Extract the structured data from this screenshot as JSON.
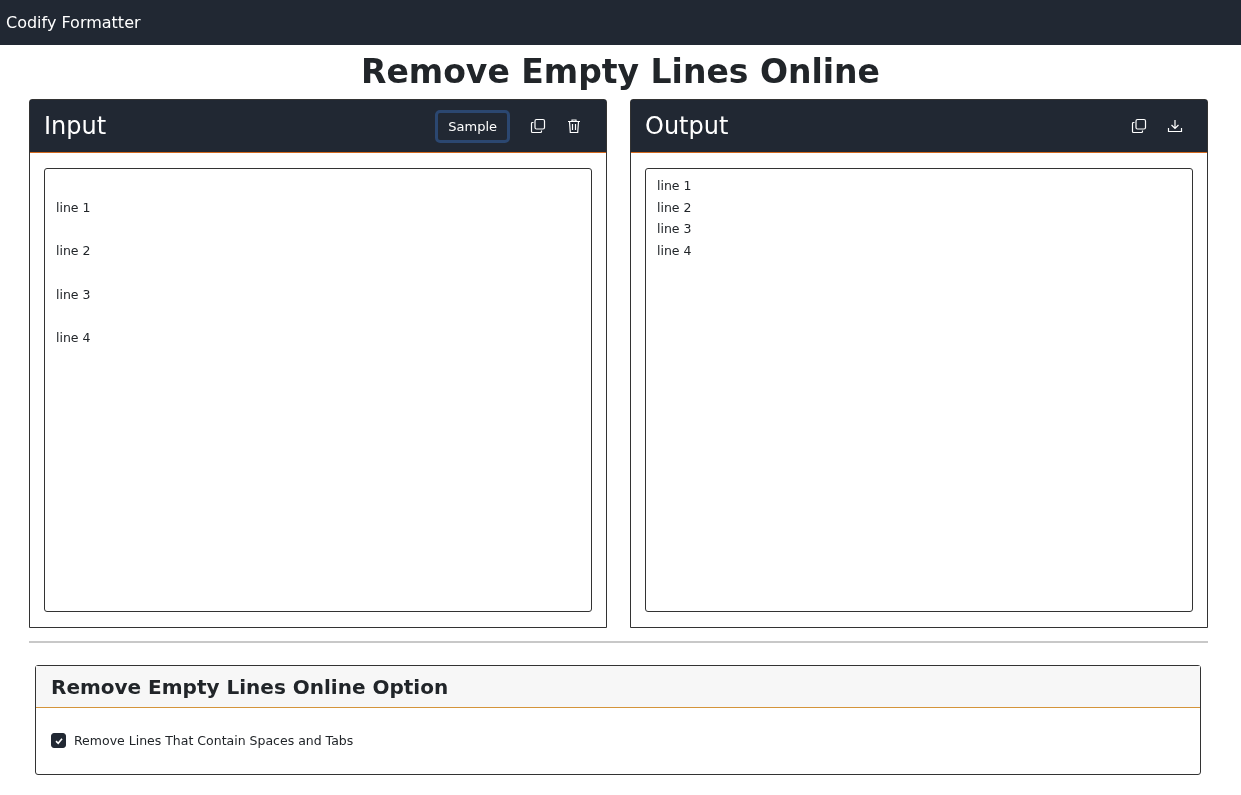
{
  "navbar": {
    "brand": "Codify Formatter"
  },
  "page_title": "Remove Empty Lines Online",
  "input_panel": {
    "title": "Input",
    "sample_button": "Sample",
    "value": "\nline 1\n\nline 2\n\nline 3\n\nline 4"
  },
  "output_panel": {
    "title": "Output",
    "value": "line 1\nline 2\nline 3\nline 4"
  },
  "options": {
    "title": "Remove Empty Lines Online Option",
    "items": [
      {
        "label": "Remove Lines That Contain Spaces and Tabs",
        "checked": true
      }
    ]
  }
}
